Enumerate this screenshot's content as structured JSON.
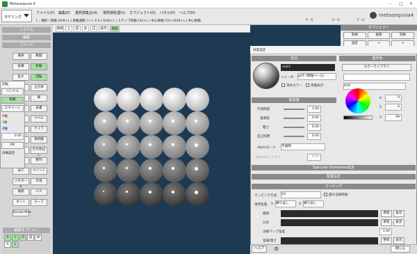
{
  "title": "Metasequoia 4",
  "mode": "モデリング",
  "menu": [
    "ファイル(F)",
    "編集(E)",
    "選択部集合(A)",
    "選択部処理(S)",
    "オブジェクト(O)",
    "パネル(P)",
    "ヘルプ(H)"
  ],
  "shortcuts": "L : 選択・移動 Shift+L | 移動選択 (ハンドル) Shift+L | ステップ移動 Ctrl+L | 中心移動 Ctrl+Shift+L | 中心移動",
  "status": {
    "p": "P : 0",
    "v": "V : 0",
    "face": "F : 0"
  },
  "logo": "metasequoia4",
  "left": {
    "system": "システム",
    "edit": "編集",
    "command": "コマンド",
    "tools": [
      "選択",
      "範囲",
      "投縄",
      "移動",
      "拡大",
      "回転",
      "面取",
      "立方体",
      "頂点",
      "線",
      "面生成",
      "表裏",
      "押出",
      "ベベル",
      "削除",
      "ナイフ",
      "接合",
      "連続面",
      "分割",
      "引き伸ばし",
      "絞り",
      "整列",
      "加工",
      "ペイント",
      "メタボール",
      "計測",
      "展開",
      "パス",
      "ボーン",
      "モーフ",
      "RenderMan"
    ],
    "popup": [
      "回転",
      "ハンドル",
      "移動",
      "スクリーン",
      "X軸",
      "Y軸",
      "Z軸",
      "0.00",
      "OK",
      "詳細設定"
    ],
    "editopt": "編集オプション",
    "xyz": [
      "X",
      "Y",
      "Z",
      "自",
      "W",
      "S",
      "L"
    ]
  },
  "view": [
    "透視",
    "上",
    "前",
    "左",
    "正",
    "表示",
    "描画"
  ],
  "right": {
    "title": "オブジェクト",
    "buttons": [
      "新規",
      "複製",
      "削除"
    ],
    "settings": "設定",
    "arrows": [
      "<",
      ">"
    ]
  },
  "dialog": {
    "title": "材質設定",
    "name_h": "名前",
    "name": "mat1",
    "shader_l": "シェーダ",
    "shader": "glTF (物理ベース)",
    "vcol": "頂点カラー",
    "double": "両面表示",
    "basic": "基本色",
    "lib": "カラーライブラリ",
    "hsv": "HSV",
    "h": "H",
    "s": "S",
    "v": "V",
    "hv": "0",
    "sv": "0",
    "vv": "99",
    "props_h": "基底値",
    "props": [
      [
        "不透明度",
        "1.00"
      ],
      [
        "金属度",
        "0.00"
      ],
      [
        "粗さ",
        "0.00"
      ],
      [
        "自己照明",
        "0.00"
      ]
    ],
    "alpha_l": "Alphaモード",
    "alpha": "不透明",
    "cutoff_l": "Alphaカットオフ",
    "cutoff": "0.50",
    "specgl": "Specular-Glossiness設定",
    "detail": "配置設定",
    "mapping": "マッピング",
    "map_l": "マッピング方式",
    "map": "UV",
    "apply": "面の法線移動",
    "wrap_l": "境界処理",
    "u": "U",
    "wrap": "繰り返し",
    "wrap2": "繰り返し",
    "v_l": "V",
    "maps": [
      "模様",
      "凸凹",
      "法線マップ強度",
      "金属/粗さ"
    ],
    "bump_strength": "1.00",
    "open": "参照",
    "disp": "表示",
    "help": "ヘルプ",
    "close": "閉じる"
  }
}
